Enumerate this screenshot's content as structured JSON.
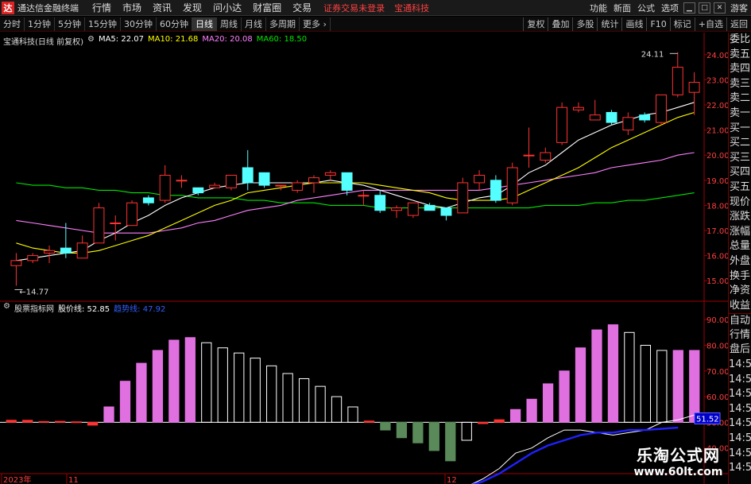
{
  "titlebar": {
    "logo": "达",
    "app_name": "通达信金融终端",
    "menu": [
      "行情",
      "市场",
      "资讯",
      "发现",
      "问小达",
      "财富圈",
      "交易"
    ],
    "notice": "证券交易未登录",
    "stock_name": "宝通科技",
    "right": [
      "功能",
      "新面",
      "公式",
      "选项"
    ],
    "guest": "游客"
  },
  "periods": [
    "分时",
    "1分钟",
    "5分钟",
    "15分钟",
    "30分钟",
    "60分钟",
    "日线",
    "周线",
    "月线",
    "多周期",
    "更多 ›"
  ],
  "active_period": "日线",
  "tools": [
    "复权",
    "叠加",
    "多股",
    "统计",
    "画线",
    "F10",
    "标记",
    "+自选",
    "返回"
  ],
  "main_legend": {
    "stock": "宝通科技(日线 前复权)",
    "ma5": "MA5: 22.07",
    "ma10": "MA10: 21.68",
    "ma20": "MA20: 20.08",
    "ma60": "MA60: 18.50"
  },
  "sub_legend": {
    "name": "股票指标网",
    "l1": "股价线: 52.85",
    "l2": "趋势线: 47.92"
  },
  "colors": {
    "up": "#ff3232",
    "down": "#54ffff",
    "ma5": "#ffffff",
    "ma10": "#ffff00",
    "ma20": "#ff80ff",
    "ma60": "#00e600",
    "line_blue": "#2020ff",
    "pos_bar": "#e070e0",
    "neg_bar": "#5a8a5a"
  },
  "price_axis": [
    "24.00",
    "23.00",
    "22.00",
    "21.00",
    "20.00",
    "19.00",
    "18.00",
    "17.00",
    "16.00",
    "15.00"
  ],
  "sub_axis": [
    "90.00",
    "80.00",
    "70.00",
    "60.00",
    "50.00",
    "40.00"
  ],
  "sub_current": "51.52",
  "annotations": {
    "high": "24.11",
    "low": "14.77"
  },
  "date_labels": [
    "2023年",
    "11",
    "12"
  ],
  "sidebar": [
    "委比",
    "卖五",
    "卖四",
    "卖三",
    "卖二",
    "卖一",
    "买一",
    "买二",
    "买三",
    "买四",
    "买五",
    "现价",
    "涨跌",
    "涨幅",
    "总量",
    "外盘",
    "换手",
    "净资",
    "收益",
    "自动",
    "行情",
    "盘后",
    "14:5",
    "14:5",
    "14:5",
    "14:5",
    "14:5",
    "14:5",
    "14:5",
    "14:5"
  ],
  "watermark": {
    "line1": "乐淘公式网",
    "line2": "www.60lt.com"
  },
  "chart_data": {
    "type": "candlestick",
    "y_range": [
      14.5,
      24.5
    ],
    "candles": [
      {
        "o": 15.6,
        "h": 16.1,
        "l": 14.8,
        "c": 15.8
      },
      {
        "o": 15.8,
        "h": 16.1,
        "l": 15.7,
        "c": 16.0
      },
      {
        "o": 16.1,
        "h": 16.4,
        "l": 15.7,
        "c": 16.2
      },
      {
        "o": 16.3,
        "h": 17.3,
        "l": 15.9,
        "c": 16.1
      },
      {
        "o": 15.9,
        "h": 16.8,
        "l": 15.9,
        "c": 16.5
      },
      {
        "o": 16.5,
        "h": 18.1,
        "l": 16.5,
        "c": 17.9
      },
      {
        "o": 17.3,
        "h": 17.6,
        "l": 16.6,
        "c": 17.3
      },
      {
        "o": 17.2,
        "h": 18.2,
        "l": 17.2,
        "c": 18.1
      },
      {
        "o": 18.3,
        "h": 18.4,
        "l": 18.0,
        "c": 18.1
      },
      {
        "o": 18.2,
        "h": 19.6,
        "l": 18.1,
        "c": 19.2
      },
      {
        "o": 19.0,
        "h": 19.2,
        "l": 18.7,
        "c": 19.0
      },
      {
        "o": 18.7,
        "h": 18.7,
        "l": 18.4,
        "c": 18.5
      },
      {
        "o": 18.7,
        "h": 18.9,
        "l": 18.7,
        "c": 18.8
      },
      {
        "o": 18.7,
        "h": 19.2,
        "l": 18.6,
        "c": 19.2
      },
      {
        "o": 19.5,
        "h": 20.2,
        "l": 18.6,
        "c": 18.9
      },
      {
        "o": 19.3,
        "h": 19.3,
        "l": 18.7,
        "c": 18.8
      },
      {
        "o": 18.8,
        "h": 18.8,
        "l": 18.6,
        "c": 18.8
      },
      {
        "o": 18.6,
        "h": 19.0,
        "l": 18.5,
        "c": 18.9
      },
      {
        "o": 18.9,
        "h": 19.2,
        "l": 18.5,
        "c": 19.1
      },
      {
        "o": 19.2,
        "h": 19.4,
        "l": 19.0,
        "c": 19.3
      },
      {
        "o": 19.3,
        "h": 19.3,
        "l": 18.4,
        "c": 18.6
      },
      {
        "o": 18.4,
        "h": 18.6,
        "l": 18.0,
        "c": 18.4
      },
      {
        "o": 18.4,
        "h": 18.6,
        "l": 17.7,
        "c": 17.8
      },
      {
        "o": 17.8,
        "h": 18.0,
        "l": 17.5,
        "c": 17.9
      },
      {
        "o": 17.6,
        "h": 18.0,
        "l": 17.5,
        "c": 18.1
      },
      {
        "o": 18.0,
        "h": 18.1,
        "l": 17.8,
        "c": 17.8
      },
      {
        "o": 17.9,
        "h": 17.9,
        "l": 17.4,
        "c": 17.6
      },
      {
        "o": 17.7,
        "h": 19.1,
        "l": 17.7,
        "c": 18.9
      },
      {
        "o": 18.9,
        "h": 19.4,
        "l": 18.6,
        "c": 19.2
      },
      {
        "o": 19.0,
        "h": 19.2,
        "l": 18.1,
        "c": 18.2
      },
      {
        "o": 18.1,
        "h": 19.7,
        "l": 18.0,
        "c": 19.5
      },
      {
        "o": 20.0,
        "h": 21.1,
        "l": 19.5,
        "c": 20.0
      },
      {
        "o": 19.8,
        "h": 20.3,
        "l": 19.7,
        "c": 20.1
      },
      {
        "o": 20.5,
        "h": 22.1,
        "l": 20.4,
        "c": 21.9
      },
      {
        "o": 21.8,
        "h": 22.1,
        "l": 21.7,
        "c": 21.9
      },
      {
        "o": 21.4,
        "h": 22.2,
        "l": 21.4,
        "c": 21.6
      },
      {
        "o": 21.7,
        "h": 21.8,
        "l": 21.2,
        "c": 21.3
      },
      {
        "o": 21.0,
        "h": 21.7,
        "l": 20.8,
        "c": 21.5
      },
      {
        "o": 21.6,
        "h": 21.7,
        "l": 21.3,
        "c": 21.4
      },
      {
        "o": 21.3,
        "h": 22.2,
        "l": 21.2,
        "c": 22.4
      },
      {
        "o": 22.4,
        "h": 24.1,
        "l": 22.3,
        "c": 23.5
      },
      {
        "o": 22.5,
        "h": 23.3,
        "l": 21.6,
        "c": 22.9
      }
    ],
    "ma5": [
      15.8,
      15.9,
      16.0,
      16.1,
      16.2,
      16.6,
      16.9,
      17.3,
      17.6,
      18.0,
      18.3,
      18.5,
      18.7,
      18.8,
      18.9,
      18.9,
      18.9,
      18.9,
      18.9,
      19.0,
      18.9,
      18.8,
      18.6,
      18.4,
      18.2,
      18.0,
      17.9,
      18.1,
      18.3,
      18.4,
      18.8,
      19.3,
      19.6,
      20.1,
      20.6,
      20.9,
      21.2,
      21.4,
      21.6,
      21.7,
      21.9,
      22.1
    ],
    "ma10": [
      16.5,
      16.3,
      16.2,
      16.1,
      16.1,
      16.2,
      16.4,
      16.6,
      16.8,
      17.1,
      17.4,
      17.7,
      18.0,
      18.2,
      18.5,
      18.6,
      18.7,
      18.8,
      18.9,
      18.9,
      18.9,
      18.9,
      18.8,
      18.7,
      18.6,
      18.5,
      18.3,
      18.2,
      18.2,
      18.2,
      18.3,
      18.6,
      18.9,
      19.2,
      19.5,
      19.9,
      20.3,
      20.6,
      20.9,
      21.2,
      21.5,
      21.7
    ],
    "ma20": [
      17.4,
      17.3,
      17.2,
      17.1,
      17.0,
      16.9,
      16.9,
      16.9,
      16.9,
      17.0,
      17.1,
      17.3,
      17.4,
      17.6,
      17.8,
      17.9,
      18.0,
      18.2,
      18.3,
      18.4,
      18.5,
      18.6,
      18.6,
      18.6,
      18.6,
      18.6,
      18.6,
      18.6,
      18.6,
      18.7,
      18.8,
      18.9,
      19.0,
      19.1,
      19.2,
      19.3,
      19.5,
      19.6,
      19.7,
      19.8,
      20.0,
      20.1
    ],
    "ma60": [
      18.9,
      18.8,
      18.8,
      18.7,
      18.7,
      18.6,
      18.6,
      18.5,
      18.5,
      18.4,
      18.4,
      18.3,
      18.3,
      18.3,
      18.2,
      18.2,
      18.1,
      18.1,
      18.1,
      18.0,
      18.0,
      18.0,
      17.9,
      17.9,
      17.9,
      17.9,
      17.9,
      17.9,
      17.9,
      17.9,
      17.9,
      17.9,
      18.0,
      18.0,
      18.0,
      18.1,
      18.1,
      18.2,
      18.2,
      18.3,
      18.4,
      18.5
    ],
    "sub_range": [
      30,
      95
    ],
    "sub_bars": [
      50.8,
      50.8,
      50.3,
      50.4,
      50.2,
      48.9,
      56,
      66,
      73,
      78,
      82,
      83,
      81,
      79,
      77,
      75,
      72,
      69,
      67,
      64,
      60,
      56,
      50.5,
      47,
      44,
      42,
      39,
      35,
      43,
      49.5,
      51,
      55,
      59,
      65,
      70,
      79,
      86,
      88,
      85,
      80,
      78,
      78,
      78
    ],
    "sub_line1": [
      null,
      null,
      null,
      null,
      null,
      null,
      null,
      null,
      null,
      null,
      null,
      null,
      null,
      null,
      null,
      null,
      null,
      null,
      22,
      20,
      18,
      18,
      17,
      18,
      19,
      21,
      22,
      22,
      25,
      28,
      32,
      38,
      40,
      44,
      47,
      47,
      46,
      45,
      46,
      47,
      50,
      51,
      52.85
    ],
    "sub_line2": [
      null,
      null,
      null,
      null,
      null,
      null,
      null,
      null,
      null,
      null,
      null,
      null,
      null,
      null,
      null,
      null,
      null,
      null,
      null,
      null,
      null,
      null,
      null,
      20,
      21,
      22,
      23,
      24,
      25,
      27,
      30,
      34,
      38,
      41,
      43,
      45,
      46,
      46,
      47,
      47,
      47.5,
      47.92
    ]
  }
}
